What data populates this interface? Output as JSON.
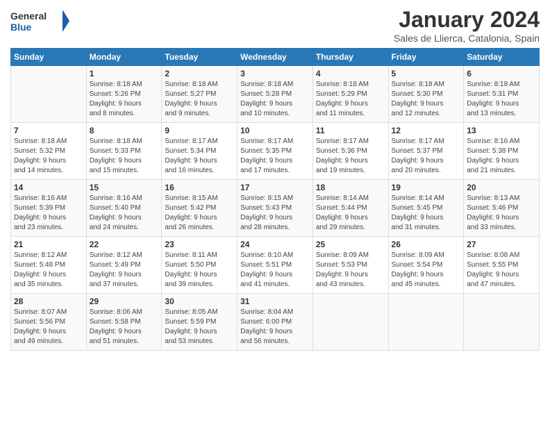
{
  "header": {
    "logo_general": "General",
    "logo_blue": "Blue",
    "title": "January 2024",
    "location": "Sales de Llierca, Catalonia, Spain"
  },
  "days_of_week": [
    "Sunday",
    "Monday",
    "Tuesday",
    "Wednesday",
    "Thursday",
    "Friday",
    "Saturday"
  ],
  "weeks": [
    [
      {
        "day": "",
        "info": ""
      },
      {
        "day": "1",
        "info": "Sunrise: 8:18 AM\nSunset: 5:26 PM\nDaylight: 9 hours\nand 8 minutes."
      },
      {
        "day": "2",
        "info": "Sunrise: 8:18 AM\nSunset: 5:27 PM\nDaylight: 9 hours\nand 9 minutes."
      },
      {
        "day": "3",
        "info": "Sunrise: 8:18 AM\nSunset: 5:28 PM\nDaylight: 9 hours\nand 10 minutes."
      },
      {
        "day": "4",
        "info": "Sunrise: 8:18 AM\nSunset: 5:29 PM\nDaylight: 9 hours\nand 11 minutes."
      },
      {
        "day": "5",
        "info": "Sunrise: 8:18 AM\nSunset: 5:30 PM\nDaylight: 9 hours\nand 12 minutes."
      },
      {
        "day": "6",
        "info": "Sunrise: 8:18 AM\nSunset: 5:31 PM\nDaylight: 9 hours\nand 13 minutes."
      }
    ],
    [
      {
        "day": "7",
        "info": "Sunrise: 8:18 AM\nSunset: 5:32 PM\nDaylight: 9 hours\nand 14 minutes."
      },
      {
        "day": "8",
        "info": "Sunrise: 8:18 AM\nSunset: 5:33 PM\nDaylight: 9 hours\nand 15 minutes."
      },
      {
        "day": "9",
        "info": "Sunrise: 8:17 AM\nSunset: 5:34 PM\nDaylight: 9 hours\nand 16 minutes."
      },
      {
        "day": "10",
        "info": "Sunrise: 8:17 AM\nSunset: 5:35 PM\nDaylight: 9 hours\nand 17 minutes."
      },
      {
        "day": "11",
        "info": "Sunrise: 8:17 AM\nSunset: 5:36 PM\nDaylight: 9 hours\nand 19 minutes."
      },
      {
        "day": "12",
        "info": "Sunrise: 8:17 AM\nSunset: 5:37 PM\nDaylight: 9 hours\nand 20 minutes."
      },
      {
        "day": "13",
        "info": "Sunrise: 8:16 AM\nSunset: 5:38 PM\nDaylight: 9 hours\nand 21 minutes."
      }
    ],
    [
      {
        "day": "14",
        "info": "Sunrise: 8:16 AM\nSunset: 5:39 PM\nDaylight: 9 hours\nand 23 minutes."
      },
      {
        "day": "15",
        "info": "Sunrise: 8:16 AM\nSunset: 5:40 PM\nDaylight: 9 hours\nand 24 minutes."
      },
      {
        "day": "16",
        "info": "Sunrise: 8:15 AM\nSunset: 5:42 PM\nDaylight: 9 hours\nand 26 minutes."
      },
      {
        "day": "17",
        "info": "Sunrise: 8:15 AM\nSunset: 5:43 PM\nDaylight: 9 hours\nand 28 minutes."
      },
      {
        "day": "18",
        "info": "Sunrise: 8:14 AM\nSunset: 5:44 PM\nDaylight: 9 hours\nand 29 minutes."
      },
      {
        "day": "19",
        "info": "Sunrise: 8:14 AM\nSunset: 5:45 PM\nDaylight: 9 hours\nand 31 minutes."
      },
      {
        "day": "20",
        "info": "Sunrise: 8:13 AM\nSunset: 5:46 PM\nDaylight: 9 hours\nand 33 minutes."
      }
    ],
    [
      {
        "day": "21",
        "info": "Sunrise: 8:12 AM\nSunset: 5:48 PM\nDaylight: 9 hours\nand 35 minutes."
      },
      {
        "day": "22",
        "info": "Sunrise: 8:12 AM\nSunset: 5:49 PM\nDaylight: 9 hours\nand 37 minutes."
      },
      {
        "day": "23",
        "info": "Sunrise: 8:11 AM\nSunset: 5:50 PM\nDaylight: 9 hours\nand 39 minutes."
      },
      {
        "day": "24",
        "info": "Sunrise: 8:10 AM\nSunset: 5:51 PM\nDaylight: 9 hours\nand 41 minutes."
      },
      {
        "day": "25",
        "info": "Sunrise: 8:09 AM\nSunset: 5:53 PM\nDaylight: 9 hours\nand 43 minutes."
      },
      {
        "day": "26",
        "info": "Sunrise: 8:09 AM\nSunset: 5:54 PM\nDaylight: 9 hours\nand 45 minutes."
      },
      {
        "day": "27",
        "info": "Sunrise: 8:08 AM\nSunset: 5:55 PM\nDaylight: 9 hours\nand 47 minutes."
      }
    ],
    [
      {
        "day": "28",
        "info": "Sunrise: 8:07 AM\nSunset: 5:56 PM\nDaylight: 9 hours\nand 49 minutes."
      },
      {
        "day": "29",
        "info": "Sunrise: 8:06 AM\nSunset: 5:58 PM\nDaylight: 9 hours\nand 51 minutes."
      },
      {
        "day": "30",
        "info": "Sunrise: 8:05 AM\nSunset: 5:59 PM\nDaylight: 9 hours\nand 53 minutes."
      },
      {
        "day": "31",
        "info": "Sunrise: 8:04 AM\nSunset: 6:00 PM\nDaylight: 9 hours\nand 56 minutes."
      },
      {
        "day": "",
        "info": ""
      },
      {
        "day": "",
        "info": ""
      },
      {
        "day": "",
        "info": ""
      }
    ]
  ]
}
